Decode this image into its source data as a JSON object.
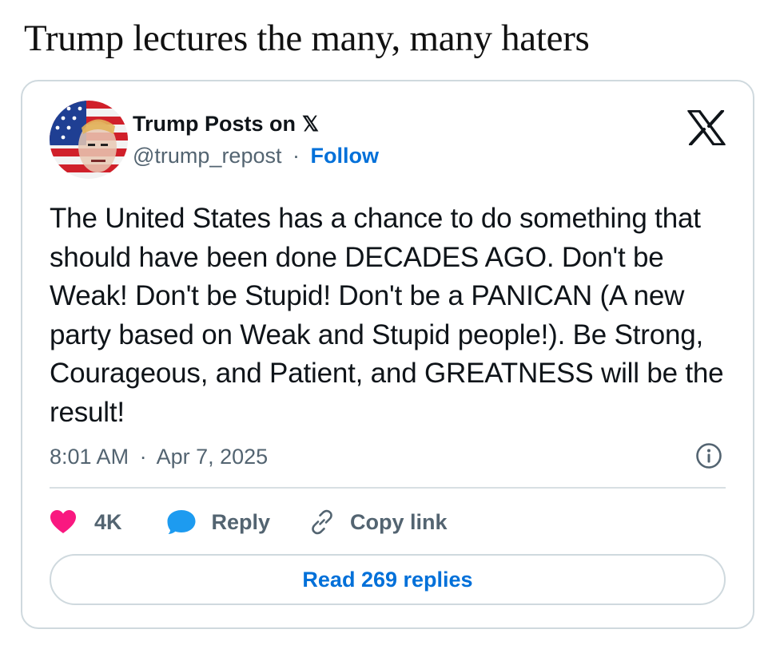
{
  "headline": "Trump lectures the many, many haters",
  "tweet": {
    "display_name": "Trump Posts on",
    "platform_glyph": "𝕏",
    "handle": "@trump_repost",
    "separator": "·",
    "follow_label": "Follow",
    "text": "The United States has a chance to do something that should have been done DECADES AGO. Don't be Weak! Don't be Stupid! Don't be a PANICAN (A new party based on Weak and Stupid people!). Be Strong, Courageous, and Patient, and GREATNESS will be the result!",
    "time": "8:01 AM",
    "date": "Apr 7, 2025",
    "likes": "4K",
    "reply_label": "Reply",
    "copy_link_label": "Copy link",
    "read_replies_label": "Read 269 replies"
  },
  "icons": {
    "x_logo": "x-logo-icon",
    "info": "info-icon",
    "heart": "heart-icon",
    "reply": "speech-bubble-icon",
    "copy_link": "link-icon"
  },
  "colors": {
    "link_blue": "#0070d9",
    "heart_pink": "#f91880",
    "reply_blue": "#1d9bf0",
    "muted_text": "#536471",
    "border": "#cfd9de"
  }
}
